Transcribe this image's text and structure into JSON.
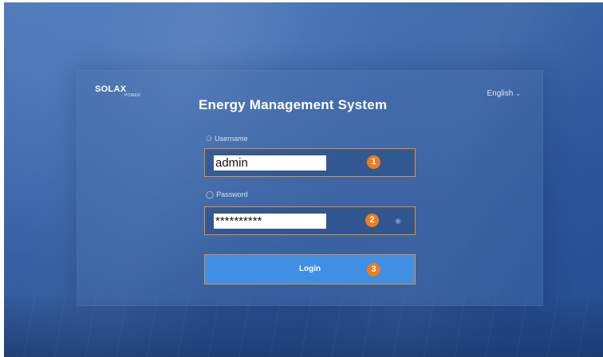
{
  "brand": {
    "logo_main": "SOLA",
    "logo_x": "X",
    "logo_sub": "POWER"
  },
  "language": {
    "selected": "English",
    "caret_icon": "chevron-down-icon"
  },
  "title": "Energy Management System",
  "username": {
    "label": "Username",
    "icon": "user-icon",
    "value": "admin",
    "callout": "1"
  },
  "password": {
    "label": "Password",
    "icon": "lock-icon",
    "value": "**********",
    "toggle_icon": "eye-icon",
    "callout": "2"
  },
  "login": {
    "label": "Login",
    "callout": "3"
  },
  "colors": {
    "accent_orange": "#ee7d1c",
    "button_blue": "#3f8fe4",
    "highlight_border": "#e8902a"
  }
}
